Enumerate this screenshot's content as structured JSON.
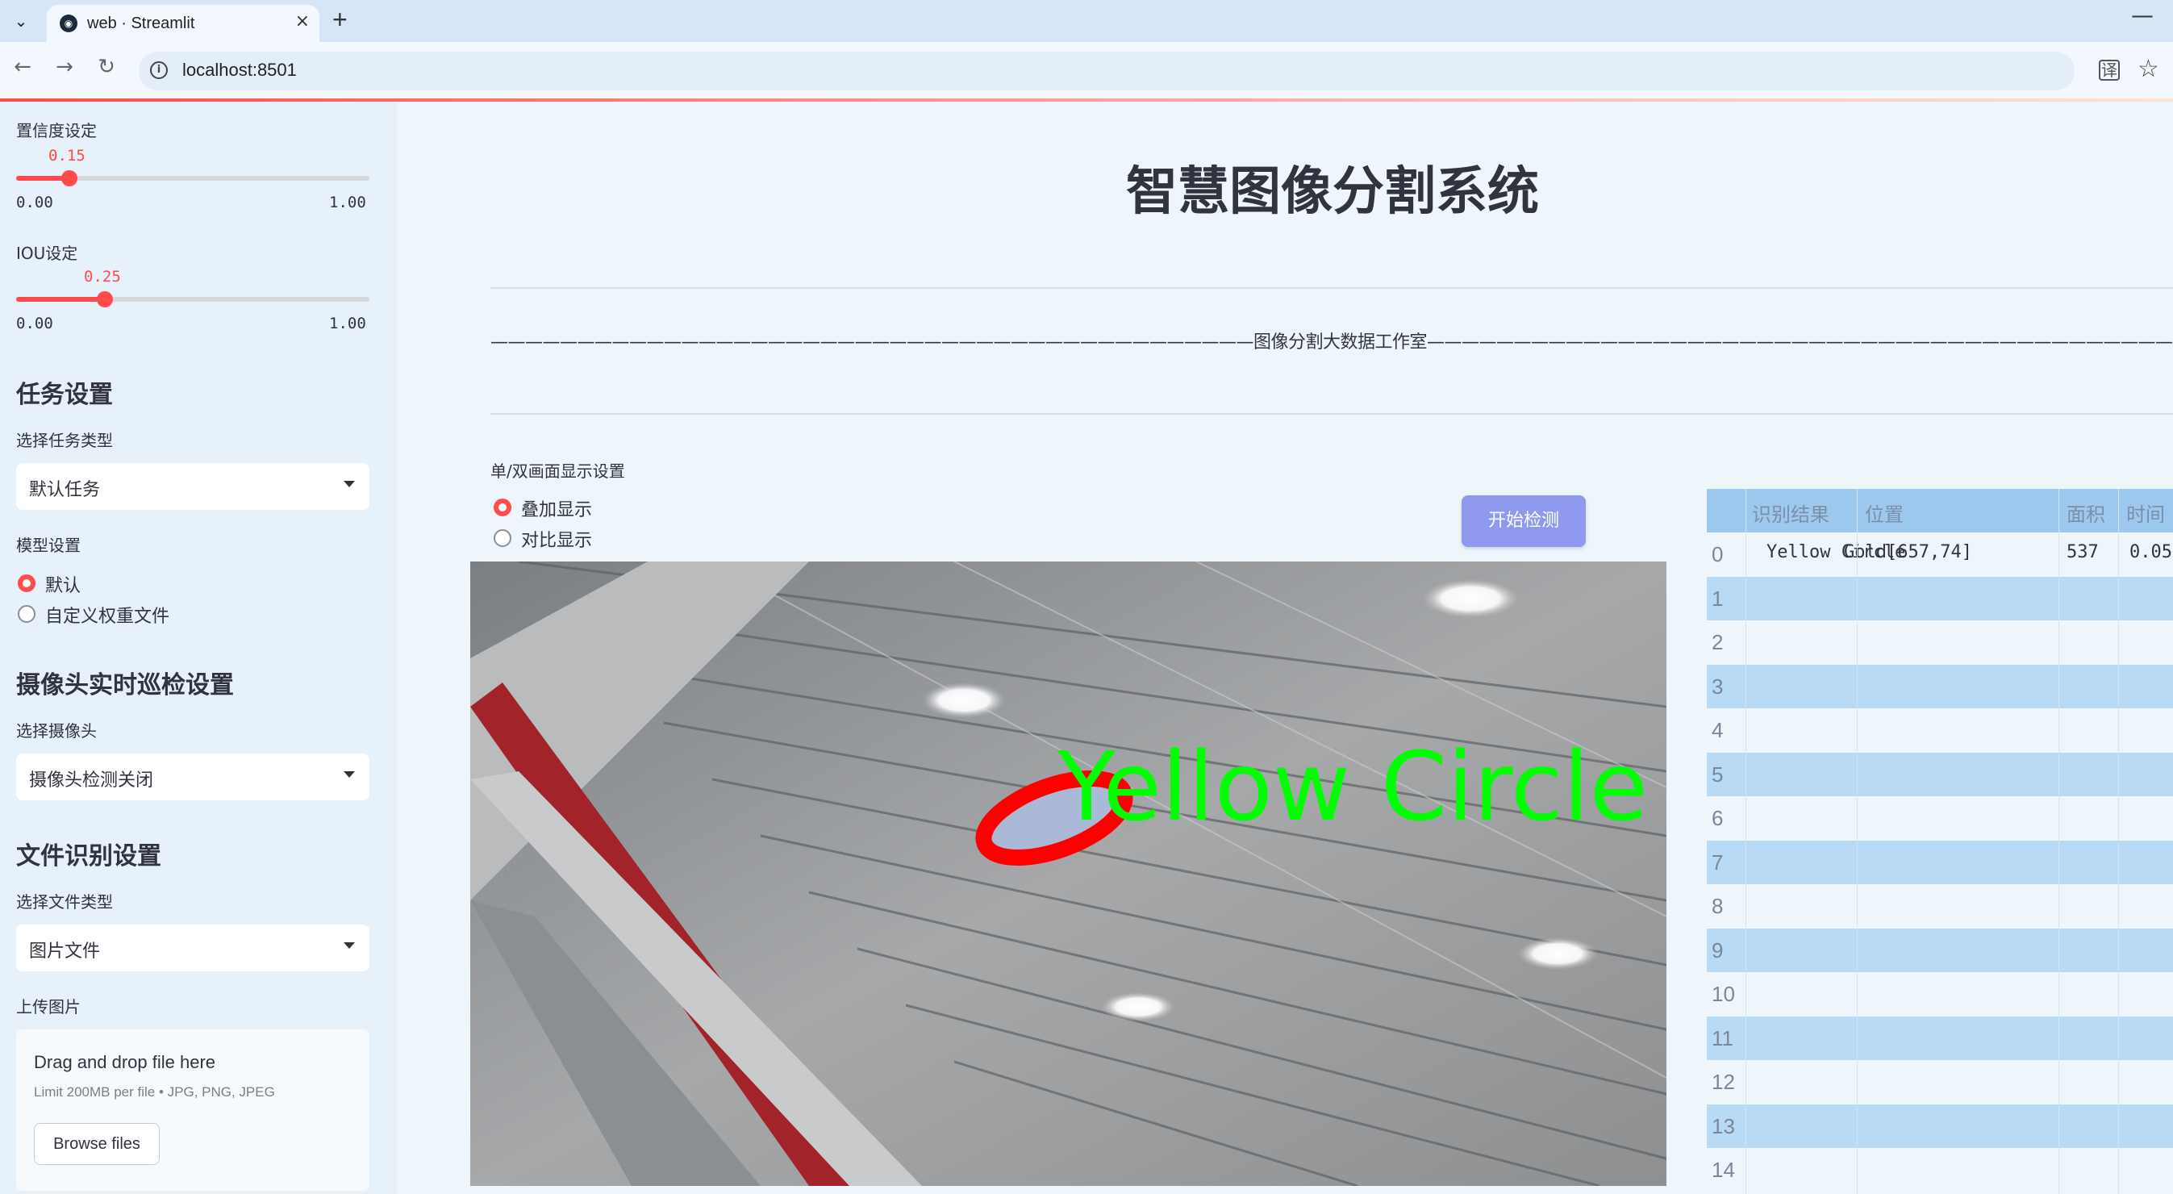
{
  "browser": {
    "tab_title": "web · Streamlit",
    "tab_close": "×",
    "new_tab": "+",
    "minimize": "—",
    "url": "localhost:8501",
    "back": "←",
    "forward": "→",
    "reload": "↻",
    "star": "☆",
    "translate": "译"
  },
  "sidebar": {
    "confidence": {
      "label": "置信度设定",
      "value": "0.15",
      "min": "0.00",
      "max": "1.00",
      "fraction": 0.15
    },
    "iou": {
      "label": "IOU设定",
      "value": "0.25",
      "min": "0.00",
      "max": "1.00",
      "fraction": 0.25
    },
    "task_heading": "任务设置",
    "task_type_label": "选择任务类型",
    "task_type_value": "默认任务",
    "model_label": "模型设置",
    "model_options": [
      "默认",
      "自定义权重文件"
    ],
    "model_selected": 0,
    "camera_heading": "摄像头实时巡检设置",
    "camera_label": "选择摄像头",
    "camera_value": "摄像头检测关闭",
    "file_heading": "文件识别设置",
    "file_type_label": "选择文件类型",
    "file_type_value": "图片文件",
    "upload_label": "上传图片",
    "upload_title": "Drag and drop file here",
    "upload_limit": "Limit 200MB per file • JPG, PNG, JPEG",
    "browse_label": "Browse files"
  },
  "main": {
    "title": "智慧图像分割系统",
    "studio_line": "————————————————————————————————————————————图像分割大数据工作室——————————————————————————————————————————————",
    "display_label": "单/双画面显示设置",
    "display_options": [
      "叠加显示",
      "对比显示"
    ],
    "display_selected": 0,
    "start_button": "开始检测",
    "overlay_text": "Yellow Circle"
  },
  "results_table": {
    "headers": [
      "识别结果",
      "位置",
      "面积",
      "时间"
    ],
    "rows": [
      {
        "index": "0",
        "result": "Yellow Circle",
        "position": "Gold[657,74]",
        "area": "537",
        "time": "0.05"
      },
      {
        "index": "1"
      },
      {
        "index": "2"
      },
      {
        "index": "3"
      },
      {
        "index": "4"
      },
      {
        "index": "5"
      },
      {
        "index": "6"
      },
      {
        "index": "7"
      },
      {
        "index": "8"
      },
      {
        "index": "9"
      },
      {
        "index": "10"
      },
      {
        "index": "11"
      },
      {
        "index": "12"
      },
      {
        "index": "13"
      },
      {
        "index": "14"
      }
    ]
  },
  "colors": {
    "accent": "#ff4b4b",
    "button": "#8e99ef",
    "table_stripe": "#b9daf5",
    "table_header": "#9ec9ee"
  }
}
